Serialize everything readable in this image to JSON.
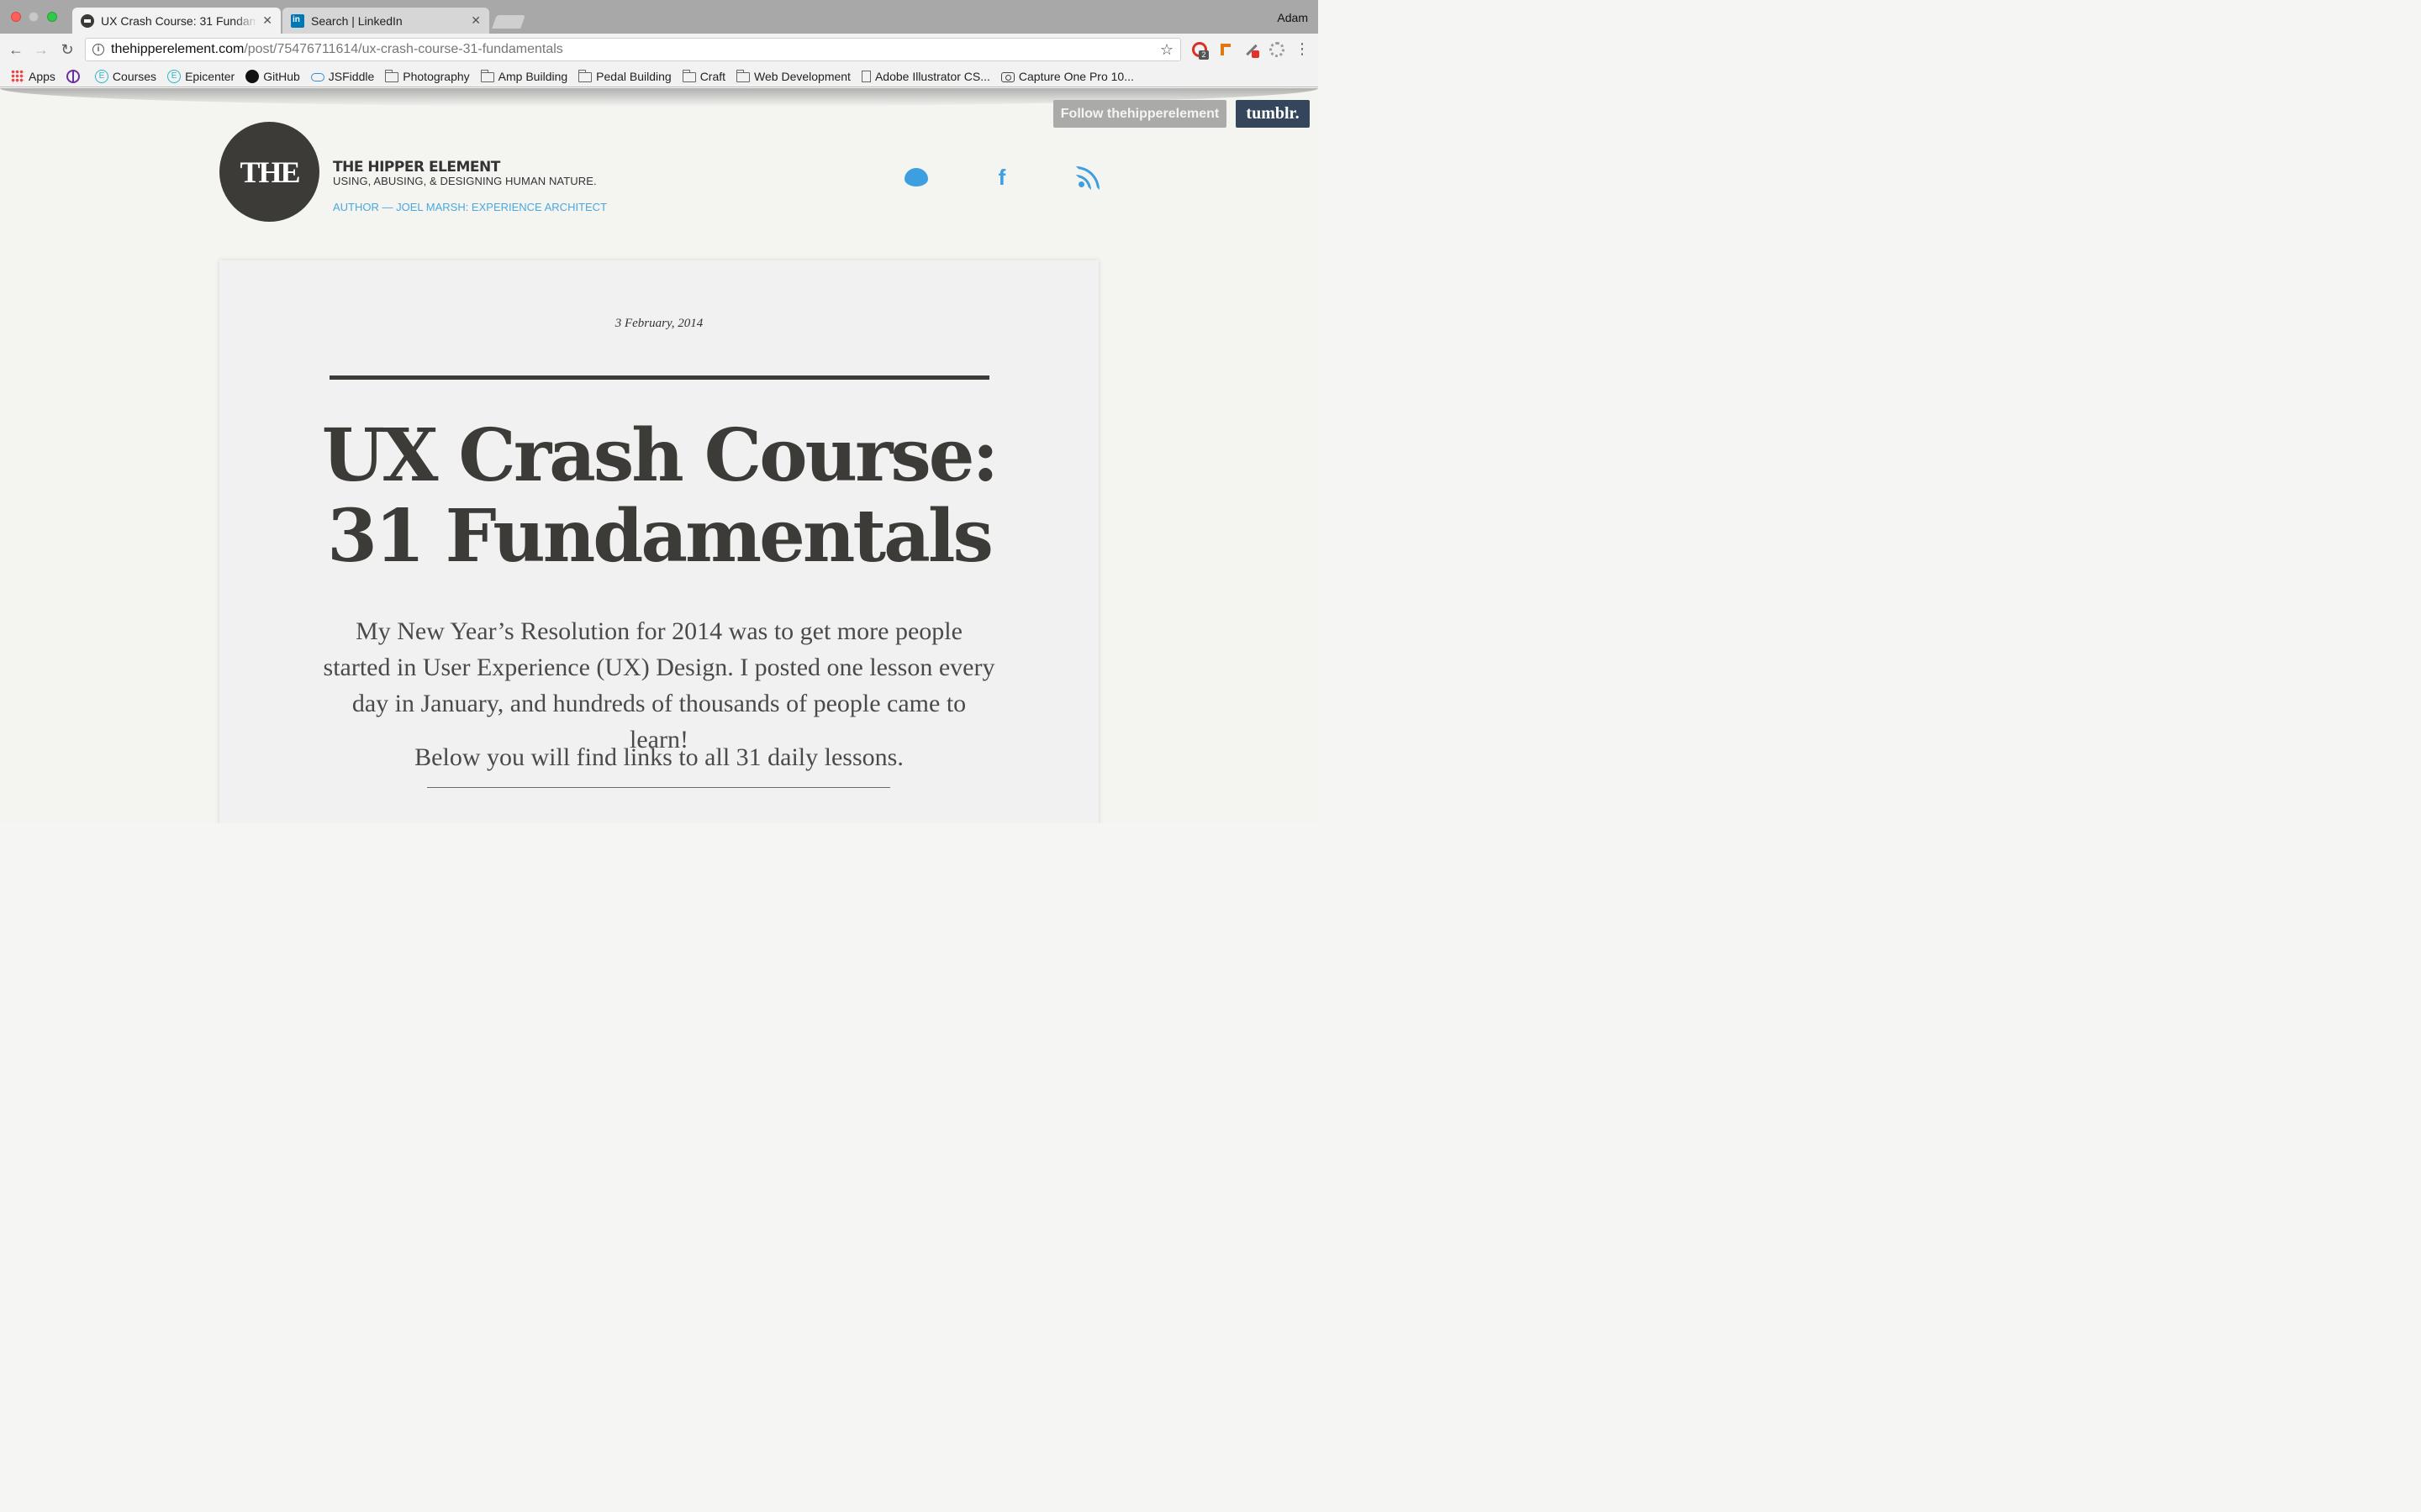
{
  "browser": {
    "tabs": [
      {
        "title": "UX Crash Course: 31 Fundamentals",
        "active": true
      },
      {
        "title": "Search | LinkedIn",
        "active": false
      }
    ],
    "profile": "Adam",
    "address": {
      "host": "thehipperelement.com",
      "path": "/post/75476711614/ux-crash-course-31-fundamentals"
    },
    "extension_badge": "2",
    "bookmarks": [
      {
        "label": "Apps",
        "icon": "apps-grid-icon"
      },
      {
        "label": "",
        "icon": "peace-icon"
      },
      {
        "label": "Courses",
        "icon": "epicenter-icon"
      },
      {
        "label": "Epicenter",
        "icon": "epicenter-icon"
      },
      {
        "label": "GitHub",
        "icon": "github-icon"
      },
      {
        "label": "JSFiddle",
        "icon": "cloud-icon"
      },
      {
        "label": "Photography",
        "icon": "folder-icon"
      },
      {
        "label": "Amp Building",
        "icon": "folder-icon"
      },
      {
        "label": "Pedal Building",
        "icon": "folder-icon"
      },
      {
        "label": "Craft",
        "icon": "folder-icon"
      },
      {
        "label": "Web Development",
        "icon": "folder-icon"
      },
      {
        "label": "Adobe Illustrator CS...",
        "icon": "document-icon"
      },
      {
        "label": "Capture One Pro 10...",
        "icon": "camera-icon"
      }
    ]
  },
  "site": {
    "follow_label": "Follow thehipperelement",
    "tumblr_label": "tumblr.",
    "logo_text": "THE",
    "title": "THE HIPPER ELEMENT",
    "tagline": "USING, ABUSING, & DESIGNING HUMAN NATURE.",
    "author": "AUTHOR — JOEL MARSH: EXPERIENCE ARCHITECT",
    "accent_color": "#3e9fe0"
  },
  "post": {
    "date": "3 February, 2014",
    "title_line1": "UX Crash Course:",
    "title_line2": "31 Fundamentals",
    "intro": "My New Year’s Resolution for 2014 was to get more people started in User Experience (UX) Design. I posted one lesson every day in January, and hundreds of thousands of people came to learn!",
    "lead": "Below you will find links to all 31 daily lessons."
  }
}
